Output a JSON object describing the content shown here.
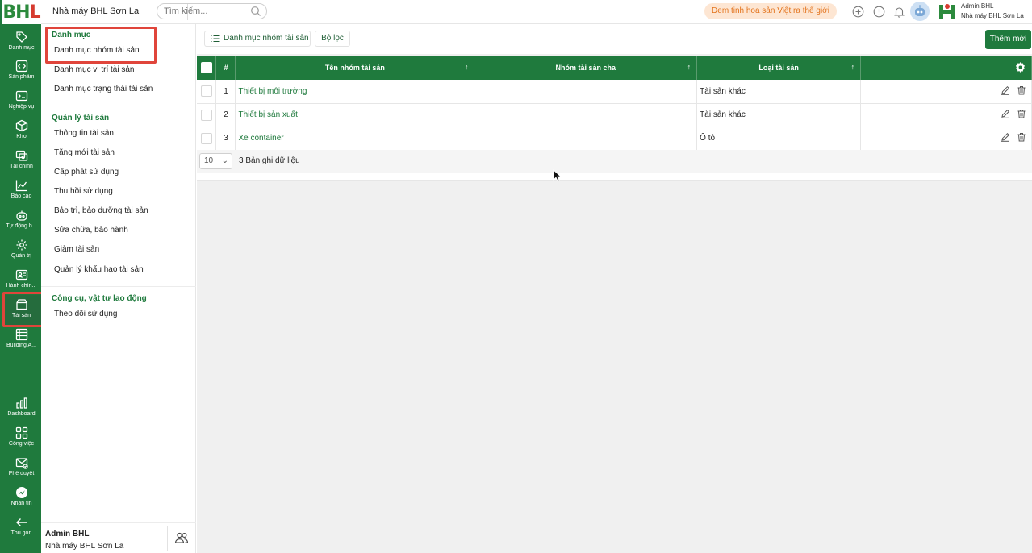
{
  "app": {
    "logo": "BHL",
    "factory": "Nhà máy BHL Sơn La",
    "slogan": "Đem tinh hoa sản Việt ra thế giới"
  },
  "search": {
    "placeholder": "Tìm kiếm..."
  },
  "user": {
    "name": "Admin BHL",
    "company": "Nhà máy BHL Sơn La"
  },
  "rail": {
    "items": [
      {
        "label": "Danh mục",
        "icon": "tag-icon"
      },
      {
        "label": "Sản phẩm",
        "icon": "code-icon"
      },
      {
        "label": "Nghiệp vụ",
        "icon": "terminal-icon"
      },
      {
        "label": "Kho",
        "icon": "box-icon"
      },
      {
        "label": "Tài chính",
        "icon": "money-icon"
      },
      {
        "label": "Báo cáo",
        "icon": "chart-icon"
      },
      {
        "label": "Tự động h...",
        "icon": "robot-icon"
      },
      {
        "label": "Quản trị",
        "icon": "gear-icon"
      },
      {
        "label": "Hành chín...",
        "icon": "id-card-icon"
      },
      {
        "label": "Tài sản",
        "icon": "archive-icon"
      },
      {
        "label": "Building A...",
        "icon": "building-icon"
      }
    ],
    "bottom": [
      {
        "label": "Dashboard",
        "icon": "bar-chart-icon"
      },
      {
        "label": "Công việc",
        "icon": "grid-icon"
      },
      {
        "label": "Phê duyệt",
        "icon": "mail-check-icon"
      },
      {
        "label": "Nhắn tin",
        "icon": "messenger-icon"
      },
      {
        "label": "Thu gọn",
        "icon": "arrow-left-icon"
      }
    ]
  },
  "sidebar": {
    "group1": "Danh mục",
    "group1_items": [
      "Danh mục nhóm tài sản",
      "Danh mục vị trí tài sản",
      "Danh mục trạng thái tài sản"
    ],
    "group2": "Quản lý tài sản",
    "group2_items": [
      "Thông tin tài sản",
      "Tăng mới tài sản",
      "Cấp phát sử dụng",
      "Thu hồi sử dụng",
      "Bảo trì, bảo dưỡng tài sản",
      "Sửa chữa, bảo hành",
      "Giảm tài sản",
      "Quản lý khấu hao tài sản"
    ],
    "group3": "Công cụ, vật tư lao động",
    "group3_items": [
      "Theo dõi sử dụng"
    ],
    "footer_name": "Admin BHL",
    "footer_company": "Nhà máy BHL Sơn La"
  },
  "toolbar": {
    "tab_list": "Danh mục nhóm tài sản",
    "tab_filter": "Bộ lọc",
    "add": "Thêm mới"
  },
  "table": {
    "headers": {
      "index": "#",
      "name": "Tên nhóm tài sản",
      "parent": "Nhóm tài sản cha",
      "type": "Loại tài sản"
    },
    "rows": [
      {
        "index": "1",
        "name": "Thiết bị môi trường",
        "parent": "",
        "type": "Tài sản khác"
      },
      {
        "index": "2",
        "name": "Thiết bị sản xuất",
        "parent": "",
        "type": "Tài sản khác"
      },
      {
        "index": "3",
        "name": "Xe container",
        "parent": "",
        "type": "Ô tô"
      }
    ],
    "page_size": "10",
    "record_count": "3 Bản ghi dữ liệu"
  },
  "colors": {
    "primary": "#1f7a3d",
    "highlight": "#e0453b",
    "slogan_bg": "#fde6d3",
    "slogan_text": "#e3731c"
  }
}
